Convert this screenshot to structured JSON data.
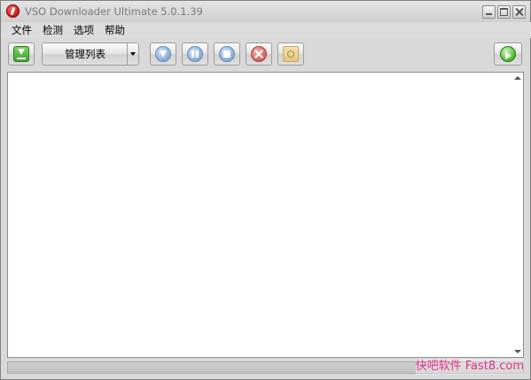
{
  "window": {
    "title": "VSO Downloader Ultimate 5.0.1.39"
  },
  "menubar": {
    "items": [
      "文件",
      "检测",
      "选项",
      "帮助"
    ]
  },
  "toolbar": {
    "download_icon": "download-icon",
    "list_combo_label": "管理列表",
    "start_icon": "download-arrow-icon",
    "pause_icon": "pause-icon",
    "stop_icon": "stop-icon",
    "delete_icon": "delete-icon",
    "open_icon": "open-folder-icon",
    "globe_icon": "globe-icon"
  },
  "watermark": {
    "text": "快吧软件 Fast8.com",
    "color": "#e0308a"
  }
}
